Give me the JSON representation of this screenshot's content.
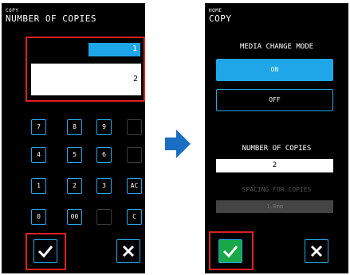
{
  "left_screen": {
    "breadcrumb": "COPY",
    "title": "NUMBER OF COPIES",
    "current_value": "1",
    "entry_value": "2",
    "keypad": [
      [
        "7",
        "8",
        "9",
        ""
      ],
      [
        "4",
        "5",
        "6",
        ""
      ],
      [
        "1",
        "2",
        "3",
        "AC"
      ],
      [
        "0",
        "00",
        "",
        "C"
      ]
    ]
  },
  "right_screen": {
    "breadcrumb": "HOME",
    "title": "COPY",
    "media_change_mode_label": "MEDIA CHANGE MODE",
    "on_label": "ON",
    "off_label": "OFF",
    "number_of_copies_label": "NUMBER OF COPIES",
    "number_of_copies_value": "2",
    "spacing_label": "SPACING FOR COPIES",
    "spacing_value": "1.0mm"
  },
  "colors": {
    "accent_blue": "#1fa6e8",
    "highlight_red": "#e02020",
    "confirm_green": "#18a848",
    "arrow_blue": "#1a6fc4"
  },
  "icons": [
    "check-icon",
    "close-icon",
    "arrow-right-icon"
  ]
}
